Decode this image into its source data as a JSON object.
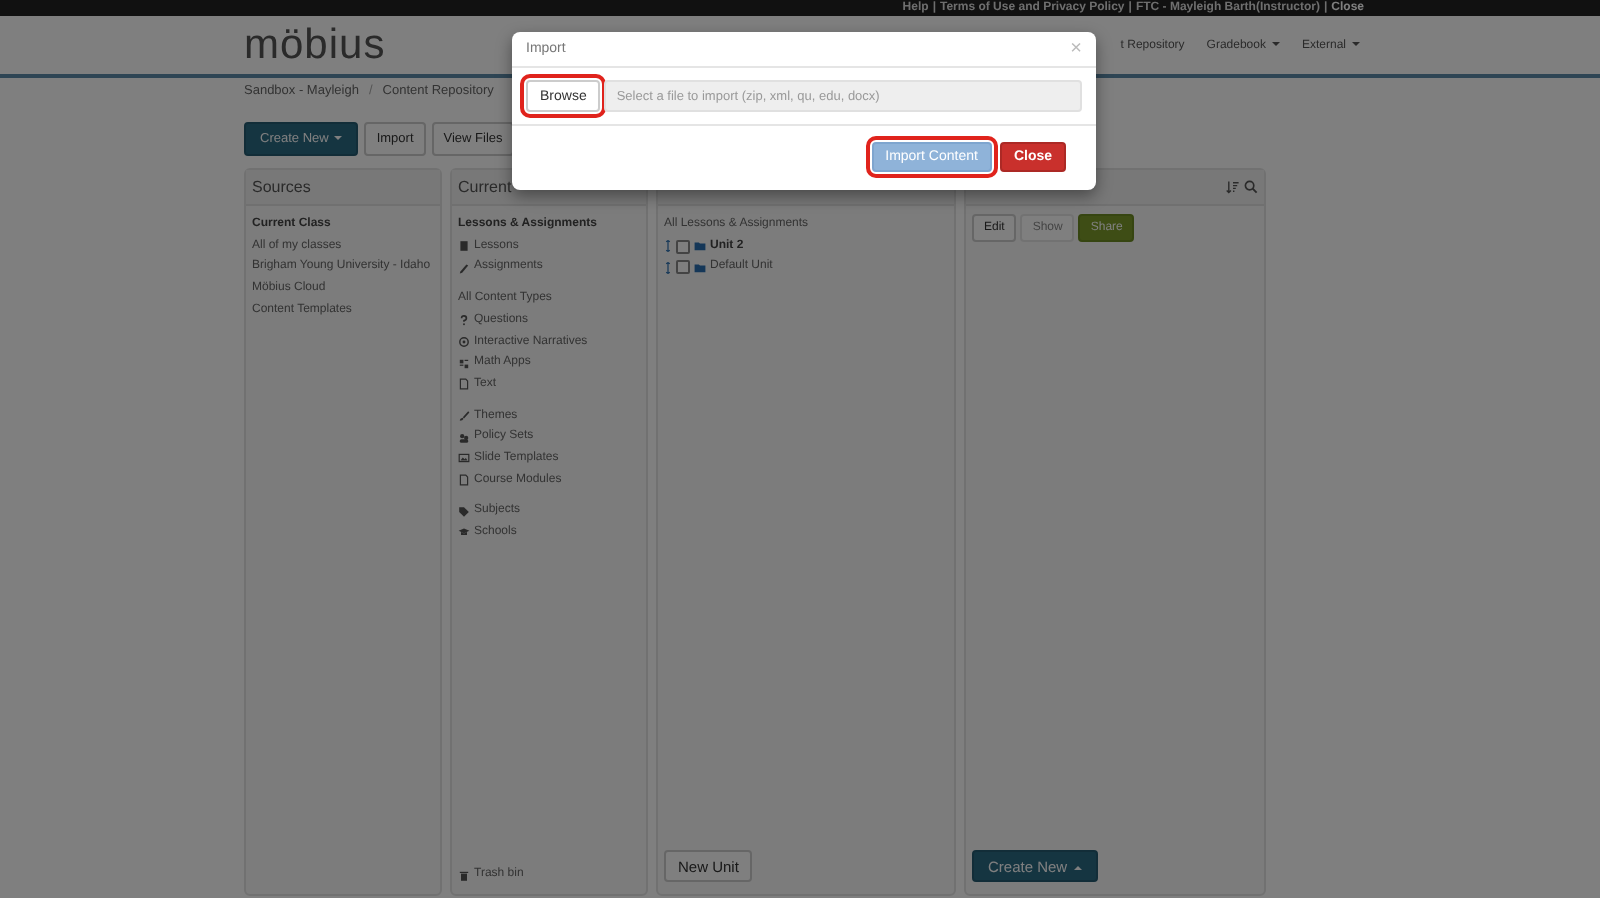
{
  "top_bar": {
    "separator": "|",
    "links": [
      "Help",
      "Terms of Use and Privacy Policy",
      "FTC - Mayleigh Barth(Instructor)",
      "Close"
    ]
  },
  "header": {
    "logo": "möbius",
    "nav": [
      {
        "label": "t Repository",
        "dropdown": false
      },
      {
        "label": "Gradebook",
        "dropdown": true
      },
      {
        "label": "External",
        "dropdown": true
      }
    ]
  },
  "breadcrumb": {
    "separator": "/",
    "items": [
      "Sandbox - Mayleigh",
      "Content Repository"
    ]
  },
  "toolbar": [
    {
      "label": "Create New",
      "kind": "primary"
    },
    {
      "label": "Import",
      "kind": "default"
    },
    {
      "label": "View Files",
      "kind": "default"
    }
  ],
  "sources": {
    "title": "Sources",
    "items": [
      {
        "label": "Current Class",
        "selected": true
      },
      {
        "label": "All of my classes",
        "selected": false
      },
      {
        "label": "Brigham Young University - Idaho",
        "selected": false
      },
      {
        "label": "Möbius Cloud",
        "selected": false
      },
      {
        "label": "Content Templates",
        "selected": false
      }
    ]
  },
  "current_class": {
    "title": "Current",
    "sections": [
      {
        "heading": {
          "label": "Lessons & Assignments",
          "selected": true
        },
        "items": [
          "Lessons",
          "Assignments"
        ]
      },
      {
        "heading": {
          "label": "All Content Types",
          "selected": false
        },
        "items": [
          "Questions",
          "Interactive Narratives",
          "Math Apps",
          "Text"
        ]
      },
      {
        "items": [
          "Themes",
          "Policy Sets",
          "Slide Templates",
          "Course Modules"
        ]
      },
      {
        "items": [
          "Subjects",
          "Schools"
        ]
      }
    ],
    "trash": "Trash bin"
  },
  "lessons": {
    "root": "All Lessons & Assignments",
    "units": [
      {
        "label": "Unit 2",
        "selected": true,
        "checked": false
      },
      {
        "label": "Default Unit",
        "selected": false,
        "checked": false
      }
    ],
    "new_button": "New Unit"
  },
  "unit_panel": {
    "buttons": [
      {
        "label": "Edit",
        "kind": "default"
      },
      {
        "label": "Show",
        "kind": "light"
      },
      {
        "label": "Share",
        "kind": "success"
      }
    ],
    "create_button": "Create New"
  },
  "modal": {
    "title": "Import",
    "close": "×",
    "browse": {
      "label": "Browse",
      "highlighted": true
    },
    "file_placeholder": "Select a file to import (zip, xml, qu, edu, docx)",
    "buttons": [
      {
        "label": "Import Content",
        "kind": "primary",
        "highlighted": true
      },
      {
        "label": "Close",
        "kind": "danger",
        "highlighted": false
      }
    ]
  }
}
